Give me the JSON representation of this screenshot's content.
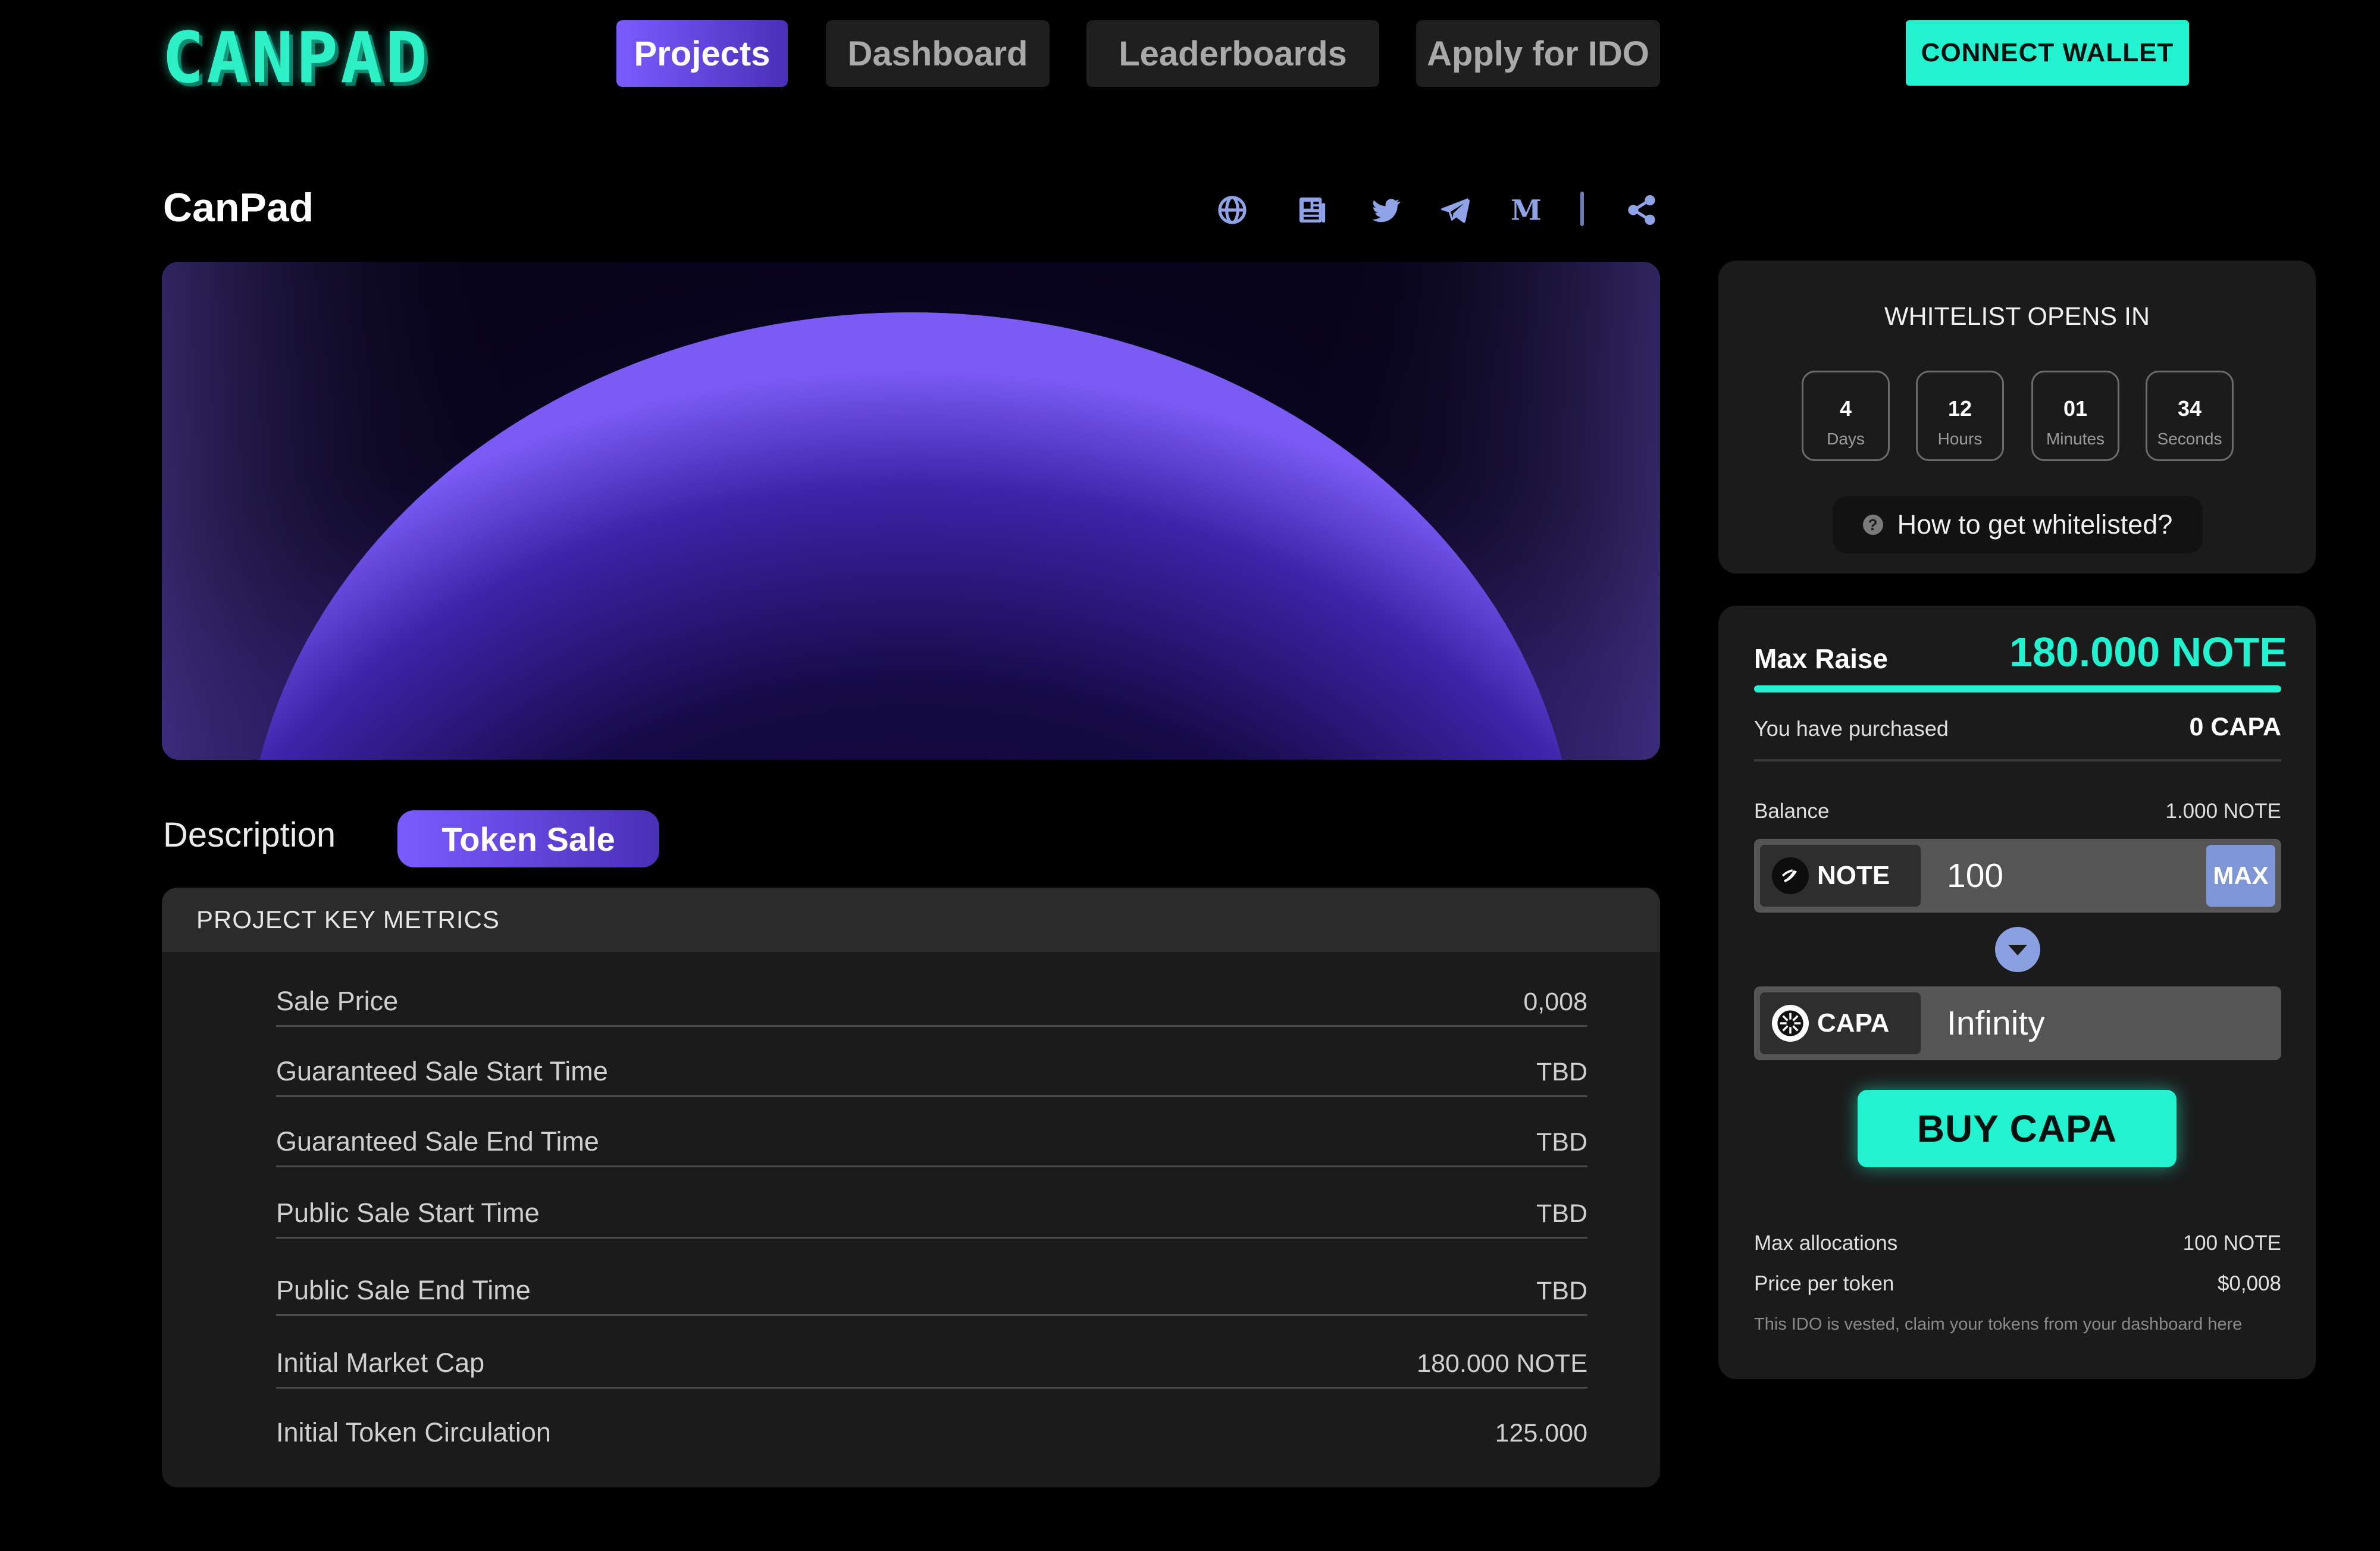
{
  "app": {
    "logo_text": "CANPAD"
  },
  "nav": {
    "items": [
      {
        "label": "Projects"
      },
      {
        "label": "Dashboard"
      },
      {
        "label": "Leaderboards"
      },
      {
        "label": "Apply for IDO"
      }
    ],
    "active_item": "Projects",
    "connect_label": "CONNECT WALLET"
  },
  "project": {
    "title": "CanPad",
    "social_icons": [
      "globe-icon",
      "news-icon",
      "twitter-icon",
      "telegram-icon",
      "medium-icon",
      "share-icon"
    ]
  },
  "tabs": {
    "description": "Description",
    "token_sale": "Token Sale",
    "active": "Token Sale"
  },
  "metrics": {
    "heading": "PROJECT KEY METRICS",
    "rows": [
      {
        "label": "Sale Price",
        "value": "0,008"
      },
      {
        "label": "Guaranteed Sale Start Time",
        "value": "TBD"
      },
      {
        "label": "Guaranteed Sale End Time",
        "value": "TBD"
      },
      {
        "label": "Public Sale Start Time",
        "value": "TBD"
      },
      {
        "label": "Public Sale End Time",
        "value": "TBD"
      },
      {
        "label": "Initial Market Cap",
        "value": "180.000 NOTE"
      },
      {
        "label": "Initial Token Circulation",
        "value": "125.000"
      }
    ]
  },
  "whitelist": {
    "title": "WHITELIST OPENS IN",
    "countdown": [
      {
        "value": "4",
        "unit": "Days"
      },
      {
        "value": "12",
        "unit": "Hours"
      },
      {
        "value": "01",
        "unit": "Minutes"
      },
      {
        "value": "34",
        "unit": "Seconds"
      }
    ],
    "help_label": "How to get whitelisted?",
    "help_icon": "question-icon"
  },
  "buy": {
    "max_raise_label": "Max Raise",
    "max_raise_value": "180.000 NOTE",
    "raise_progress": 1.0,
    "purchased_label": "You have purchased",
    "purchased_value": "0 CAPA",
    "balance_label": "Balance",
    "balance_value": "1.000 NOTE",
    "pay_token": "NOTE",
    "pay_amount": "100",
    "max_label": "MAX",
    "receive_token": "CAPA",
    "receive_amount": "Infinity",
    "buy_label": "BUY CAPA",
    "max_alloc_label": "Max allocations",
    "max_alloc_value": "100 NOTE",
    "price_label": "Price per token",
    "price_value": "$0,008",
    "vesting_note": "This IDO is vested, claim your tokens from your dashboard here"
  },
  "colors": {
    "accent_teal": "#22f2cf",
    "accent_purple": "#7b5cff",
    "panel": "#1b1b1b",
    "background": "#000000"
  }
}
